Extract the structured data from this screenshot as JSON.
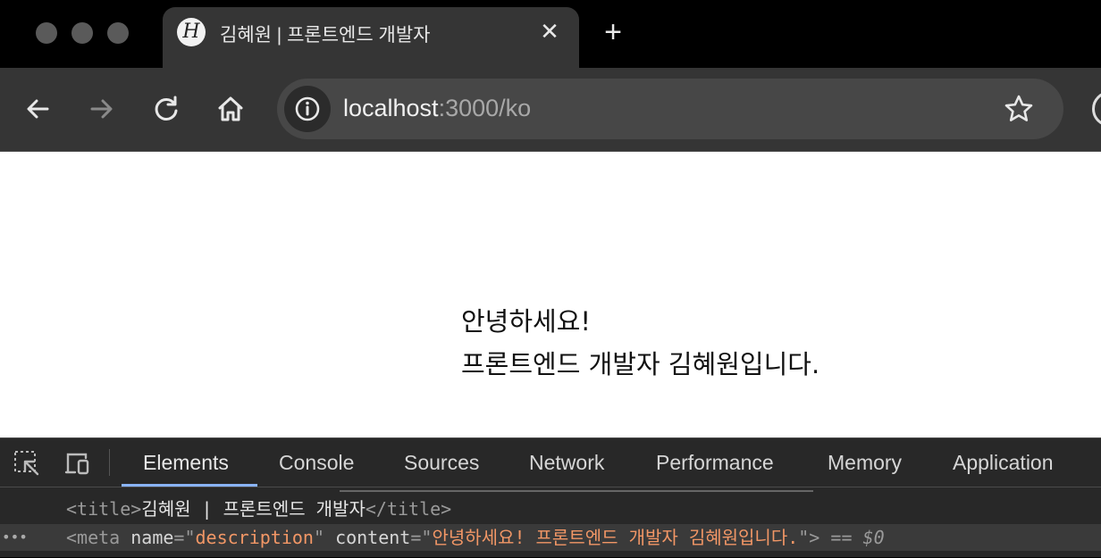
{
  "browser": {
    "tab": {
      "favicon_text": "H",
      "title": "김혜원 | 프론트엔드 개발자",
      "close_label": "✕"
    },
    "new_tab_label": "+",
    "url": {
      "host": "localhost",
      "path": ":3000/ko"
    }
  },
  "page": {
    "line1": "안녕하세요!",
    "line2": "프론트엔드 개발자 김혜원입니다."
  },
  "devtools": {
    "tabs": [
      "Elements",
      "Console",
      "Sources",
      "Network",
      "Performance",
      "Memory",
      "Application"
    ],
    "active_tab": "Elements",
    "code": {
      "line1": {
        "open_tag": "<title>",
        "text": "김혜원 | 프론트엔드 개발자",
        "close_tag": "</title>"
      },
      "line2": {
        "gutter": "•••",
        "open": "<meta ",
        "name_attr": "name",
        "eq1": "=\"",
        "name_val": "description",
        "q1": "\" ",
        "content_attr": "content",
        "eq2": "=\"",
        "content_val": "안녕하세요! 프론트엔드 개발자 김혜원입니다.",
        "close": "\">",
        "eq_sign": " == ",
        "dollar": "$0"
      }
    }
  },
  "colors": {
    "accent": "#8ab4f8",
    "attr_value": "#f29766",
    "toolbar_bg": "#353535"
  }
}
